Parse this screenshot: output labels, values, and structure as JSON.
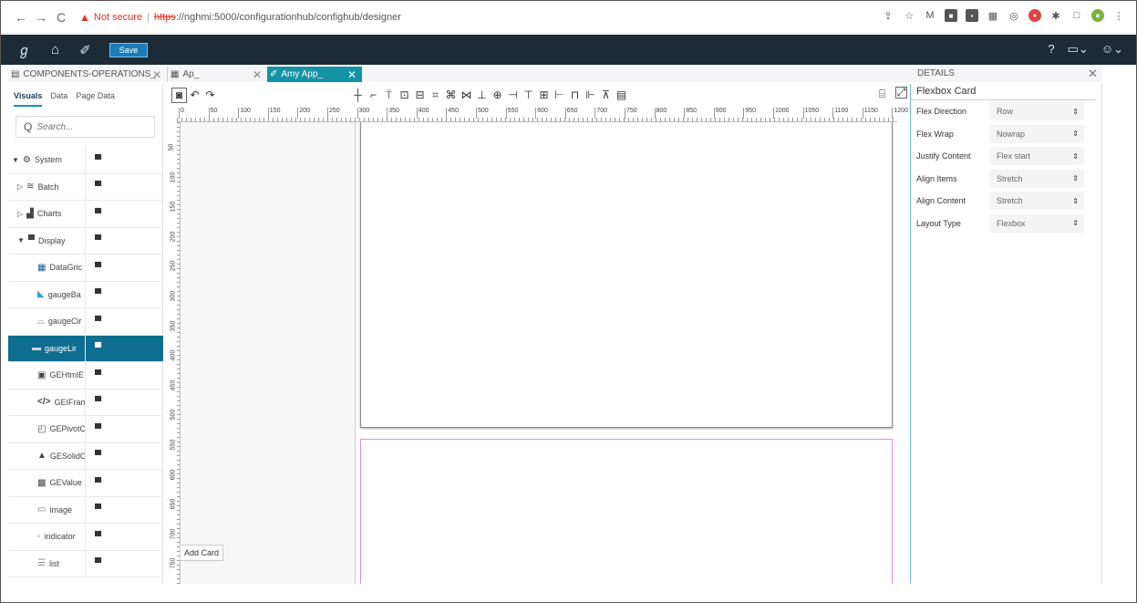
{
  "browser": {
    "not_secure": "Not secure",
    "url_proto": "https",
    "url_rest": "://nghmi:5000/configurationhub/confighub/designer"
  },
  "header": {
    "save_label": "Save"
  },
  "tabs": [
    {
      "label": "COMPONENTS-OPERATIONS_"
    },
    {
      "label": "Ap_"
    },
    {
      "label": "Amy App_"
    }
  ],
  "left_panel": {
    "subtabs": [
      "Visuals",
      "Data",
      "Page Data"
    ],
    "search_placeholder": "Search...",
    "tree": [
      {
        "label": "System",
        "icon": "system-icon"
      },
      {
        "label": "Batch",
        "icon": "batch-icon"
      },
      {
        "label": "Charts",
        "icon": "charts-icon"
      },
      {
        "label": "Display",
        "icon": "display-icon"
      },
      {
        "label": "DataGric",
        "icon": "grid-icon"
      },
      {
        "label": "gaugeBa",
        "icon": "gauge-bar-icon"
      },
      {
        "label": "gaugeCir",
        "icon": "gauge-circle-icon"
      },
      {
        "label": "gaugeLir",
        "icon": "gauge-linear-icon"
      },
      {
        "label": "GEHtmlE",
        "icon": "html-icon"
      },
      {
        "label": "GEIFram",
        "icon": "code-icon"
      },
      {
        "label": "GEPivotC",
        "icon": "pivot-icon"
      },
      {
        "label": "GESolidC",
        "icon": "solid-gauge-icon"
      },
      {
        "label": "GEValue",
        "icon": "value-icon"
      },
      {
        "label": "image",
        "icon": "image-icon"
      },
      {
        "label": "indicator",
        "icon": "indicator-icon"
      },
      {
        "label": "list",
        "icon": "list-icon"
      }
    ]
  },
  "ruler": {
    "h_ticks": [
      "0",
      "50",
      "100",
      "150",
      "200",
      "250",
      "300",
      "350",
      "400",
      "450",
      "500",
      "550",
      "600",
      "650",
      "700",
      "750",
      "800",
      "850",
      "900",
      "950",
      "1000",
      "1050",
      "1100",
      "1150",
      "1200"
    ],
    "v_ticks": [
      "50",
      "100",
      "150",
      "200",
      "250",
      "300",
      "350",
      "400",
      "450",
      "500",
      "550",
      "600",
      "650",
      "700",
      "750"
    ]
  },
  "canvas": {
    "add_card_tooltip": "Add Card"
  },
  "details": {
    "title": "DETAILS",
    "card_title": "Flexbox Card",
    "props": [
      {
        "label": "Flex Direction",
        "value": "Row"
      },
      {
        "label": "Flex Wrap",
        "value": "Nowrap"
      },
      {
        "label": "Justify Content",
        "value": "Flex start"
      },
      {
        "label": "Align Items",
        "value": "Stretch"
      },
      {
        "label": "Align Content",
        "value": "Stretch"
      },
      {
        "label": "Layout Type",
        "value": "Flexbox"
      }
    ]
  },
  "colors": {
    "header_bg": "#1d2b36",
    "accent": "#1493a6",
    "selected_row": "#0f6e8f",
    "card_highlight": "#e48be0"
  }
}
